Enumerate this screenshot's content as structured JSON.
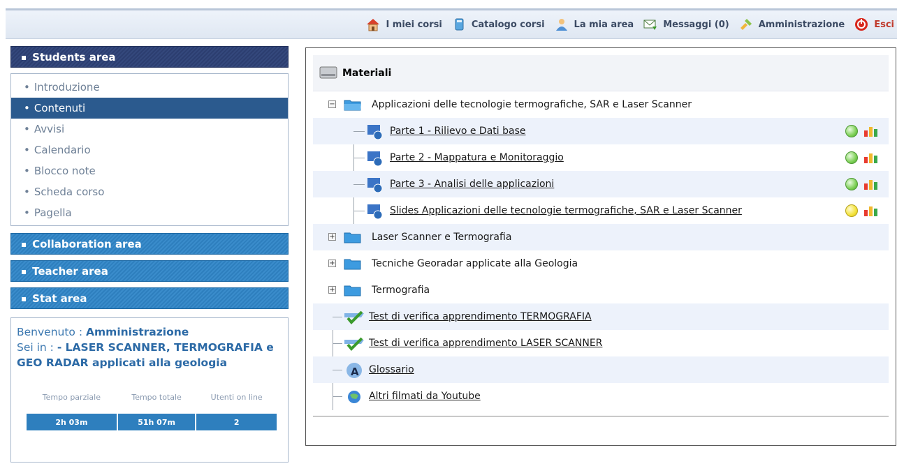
{
  "topbar": {
    "items": [
      {
        "label": "I miei corsi",
        "icon": "home-icon"
      },
      {
        "label": "Catalogo corsi",
        "icon": "catalog-icon"
      },
      {
        "label": "La mia area",
        "icon": "user-icon"
      },
      {
        "label": "Messaggi (0)",
        "icon": "message-icon"
      },
      {
        "label": "Amministrazione",
        "icon": "admin-icon"
      },
      {
        "label": "Esci",
        "icon": "exit-icon"
      }
    ]
  },
  "sidebar": {
    "students_area": "Students area",
    "menu": [
      "Introduzione",
      "Contenuti",
      "Avvisi",
      "Calendario",
      "Blocco note",
      "Scheda corso",
      "Pagella"
    ],
    "active_index": 1,
    "collaboration_area": "Collaboration area",
    "teacher_area": "Teacher area",
    "stat_area": "Stat area"
  },
  "info": {
    "welcome_label": "Benvenuto",
    "welcome_sep": ":",
    "welcome_user": "Amministrazione",
    "course_label": "Sei in :",
    "course_name": "- LASER SCANNER, TERMOGRAFIA e GEO RADAR applicati alla geologia",
    "stats_headers": [
      "Tempo parziale",
      "Tempo totale",
      "Utenti on line"
    ],
    "stats_values": [
      "2h 03m",
      "51h 07m",
      "2"
    ]
  },
  "materials": {
    "title": "Materiali",
    "folder1": "Applicazioni delle tecnologie termografiche, SAR e Laser Scanner",
    "parts": [
      {
        "label": "Parte 1 - Rilievo e Dati base",
        "status": "green"
      },
      {
        "label": "Parte 2 - Mappatura e Monitoraggio",
        "status": "green"
      },
      {
        "label": "Parte 3 - Analisi delle applicazioni",
        "status": "green"
      },
      {
        "label": "Slides  Applicazioni delle tecnologie termografiche, SAR e Laser Scanner",
        "status": "yellow"
      }
    ],
    "folders": [
      "Laser Scanner e Termografia",
      "Tecniche Georadar applicate alla Geologia",
      "Termografia"
    ],
    "tests": [
      "Test di verifica apprendimento TERMOGRAFIA",
      "Test di verifica apprendimento LASER SCANNER"
    ],
    "glossary": "Glossario",
    "videos": "Altri filmati da Youtube"
  },
  "colors": {
    "accent_blue": "#2e7fbe",
    "dark_blue": "#2c3e70",
    "active_item": "#2b5a8e",
    "status_green": "#7ccf55",
    "status_yellow": "#f3e23a"
  }
}
